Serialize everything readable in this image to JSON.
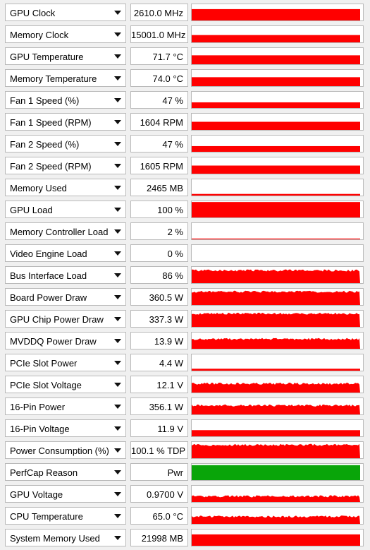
{
  "window": {
    "title": ""
  },
  "colors": {
    "graph_bar": "#ff0000",
    "perfcap_bar": "#09a509",
    "panel_background": "#f0f0f0",
    "cell_border": "#b9b9b9"
  },
  "sensors": [
    {
      "name": "GPU Clock",
      "value": "2610.0 MHz",
      "level": 0.7,
      "color": "#ff0000",
      "noise": false
    },
    {
      "name": "Memory Clock",
      "value": "15001.0 MHz",
      "level": 0.45,
      "color": "#ff0000",
      "noise": false
    },
    {
      "name": "GPU Temperature",
      "value": "71.7 °C",
      "level": 0.55,
      "color": "#ff0000",
      "noise": false
    },
    {
      "name": "Memory Temperature",
      "value": "74.0 °C",
      "level": 0.55,
      "color": "#ff0000",
      "noise": false
    },
    {
      "name": "Fan 1 Speed (%)",
      "value": "47 %",
      "level": 0.35,
      "color": "#ff0000",
      "noise": false
    },
    {
      "name": "Fan 1 Speed (RPM)",
      "value": "1604 RPM",
      "level": 0.5,
      "color": "#ff0000",
      "noise": false
    },
    {
      "name": "Fan 2 Speed (%)",
      "value": "47 %",
      "level": 0.35,
      "color": "#ff0000",
      "noise": false
    },
    {
      "name": "Fan 2 Speed (RPM)",
      "value": "1605 RPM",
      "level": 0.5,
      "color": "#ff0000",
      "noise": false
    },
    {
      "name": "Memory Used",
      "value": "2465 MB",
      "level": 0.1,
      "color": "#ff0000",
      "noise": false
    },
    {
      "name": "GPU Load",
      "value": "100 %",
      "level": 0.95,
      "color": "#ff0000",
      "noise": false
    },
    {
      "name": "Memory Controller Load",
      "value": "2 %",
      "level": 0.05,
      "color": "#ff0000",
      "noise": false
    },
    {
      "name": "Video Engine Load",
      "value": "0 %",
      "level": 0.0,
      "color": "#ff0000",
      "noise": false
    },
    {
      "name": "Bus Interface Load",
      "value": "86 %",
      "level": 0.78,
      "color": "#ff0000",
      "noise": true
    },
    {
      "name": "Board Power Draw",
      "value": "360.5 W",
      "level": 0.82,
      "color": "#ff0000",
      "noise": true
    },
    {
      "name": "GPU Chip Power Draw",
      "value": "337.3 W",
      "level": 0.82,
      "color": "#ff0000",
      "noise": true
    },
    {
      "name": "MVDDQ Power Draw",
      "value": "13.9 W",
      "level": 0.6,
      "color": "#ff0000",
      "noise": true
    },
    {
      "name": "PCIe Slot Power",
      "value": "4.4 W",
      "level": 0.12,
      "color": "#ff0000",
      "noise": false
    },
    {
      "name": "PCIe Slot Voltage",
      "value": "12.1 V",
      "level": 0.55,
      "color": "#ff0000",
      "noise": true
    },
    {
      "name": "16-Pin Power",
      "value": "356.1 W",
      "level": 0.55,
      "color": "#ff0000",
      "noise": true
    },
    {
      "name": "16-Pin Voltage",
      "value": "11.9 V",
      "level": 0.38,
      "color": "#ff0000",
      "noise": false
    },
    {
      "name": "Power Consumption (%)",
      "value": "100.1 % TDP",
      "level": 0.82,
      "color": "#ff0000",
      "noise": true
    },
    {
      "name": "PerfCap Reason",
      "value": "Pwr",
      "level": 0.92,
      "color": "#09a509",
      "noise": false
    },
    {
      "name": "GPU Voltage",
      "value": "0.9700 V",
      "level": 0.35,
      "color": "#ff0000",
      "noise": true
    },
    {
      "name": "CPU Temperature",
      "value": "65.0 °C",
      "level": 0.45,
      "color": "#ff0000",
      "noise": true
    },
    {
      "name": "System Memory Used",
      "value": "21998 MB",
      "level": 0.7,
      "color": "#ff0000",
      "noise": false
    }
  ]
}
